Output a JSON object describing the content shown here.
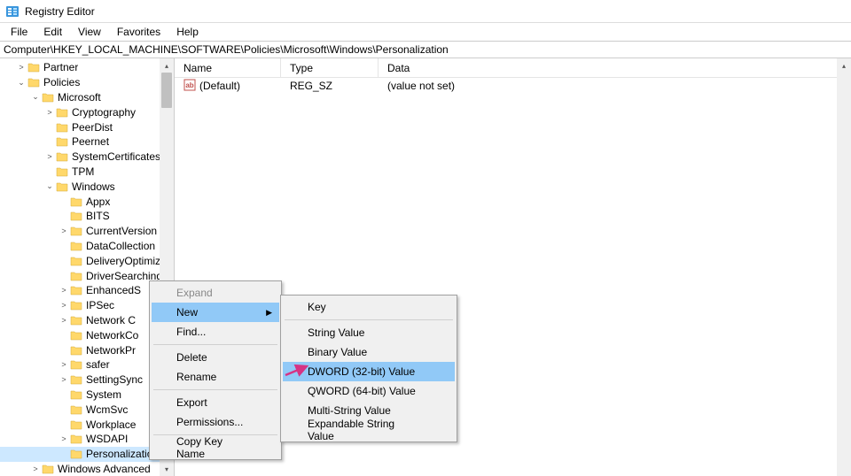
{
  "window": {
    "title": "Registry Editor"
  },
  "menubar": {
    "file": "File",
    "edit": "Edit",
    "view": "View",
    "favorites": "Favorites",
    "help": "Help"
  },
  "address": {
    "value": "Computer\\HKEY_LOCAL_MACHINE\\SOFTWARE\\Policies\\Microsoft\\Windows\\Personalization"
  },
  "tree": {
    "partner": "Partner",
    "policies": "Policies",
    "microsoft": "Microsoft",
    "items": {
      "cryptography": "Cryptography",
      "peerdist": "PeerDist",
      "peernet": "Peernet",
      "systemcertificates": "SystemCertificates",
      "tpm": "TPM",
      "windows": "Windows"
    },
    "windows_children": {
      "appx": "Appx",
      "bits": "BITS",
      "currentversion": "CurrentVersion",
      "datacollection": "DataCollection",
      "deliveryoptimiz": "DeliveryOptimiz",
      "driversearching": "DriverSearching",
      "enhanceds": "EnhancedS",
      "ipsec": "IPSec",
      "networkc1": "Network C",
      "networkc2": "NetworkCo",
      "networkpr": "NetworkPr",
      "safer": "safer",
      "settingsync": "SettingSync",
      "system": "System",
      "wcmsvc": "WcmSvc",
      "workplace": "Workplace",
      "wsdapi": "WSDAPI",
      "personalization": "Personalization"
    },
    "windowsadvanced": "Windows Advanced"
  },
  "list": {
    "headers": {
      "name": "Name",
      "type": "Type",
      "data": "Data"
    },
    "row0": {
      "name": "(Default)",
      "type": "REG_SZ",
      "data": "(value not set)"
    }
  },
  "ctx": {
    "expand": "Expand",
    "new": "New",
    "find": "Find...",
    "delete": "Delete",
    "rename": "Rename",
    "export": "Export",
    "permissions": "Permissions...",
    "copykeyname": "Copy Key Name"
  },
  "submenu": {
    "key": "Key",
    "string": "String Value",
    "binary": "Binary Value",
    "dword": "DWORD (32-bit) Value",
    "qword": "QWORD (64-bit) Value",
    "multistring": "Multi-String Value",
    "expandable": "Expandable String Value"
  }
}
